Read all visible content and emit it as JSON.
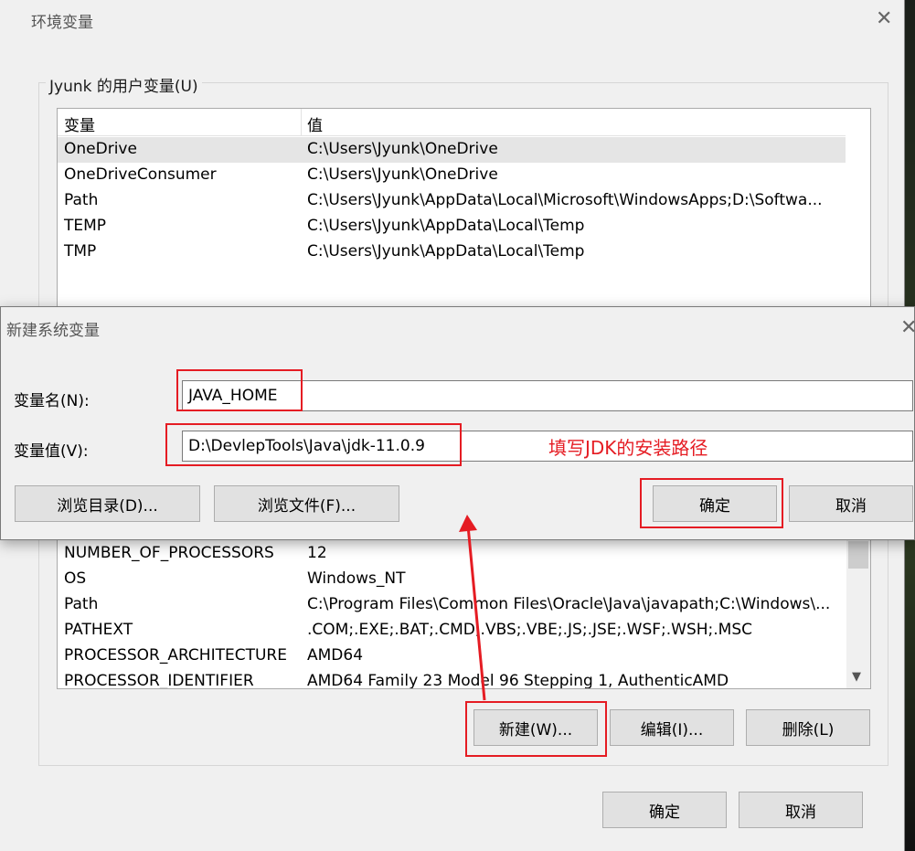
{
  "env_dialog": {
    "title": "环境变量",
    "user_group_label": "Jyunk 的用户变量(U)",
    "columns": [
      "变量",
      "值"
    ],
    "user_vars": [
      {
        "name": "OneDrive",
        "value": "C:\\Users\\Jyunk\\OneDrive"
      },
      {
        "name": "OneDriveConsumer",
        "value": "C:\\Users\\Jyunk\\OneDrive"
      },
      {
        "name": "Path",
        "value": "C:\\Users\\Jyunk\\AppData\\Local\\Microsoft\\WindowsApps;D:\\Softwa..."
      },
      {
        "name": "TEMP",
        "value": "C:\\Users\\Jyunk\\AppData\\Local\\Temp"
      },
      {
        "name": "TMP",
        "value": "C:\\Users\\Jyunk\\AppData\\Local\\Temp"
      }
    ],
    "system_vars": [
      {
        "name": "NUMBER_OF_PROCESSORS",
        "value": "12"
      },
      {
        "name": "OS",
        "value": "Windows_NT"
      },
      {
        "name": "Path",
        "value": "C:\\Program Files\\Common Files\\Oracle\\Java\\javapath;C:\\Windows\\..."
      },
      {
        "name": "PATHEXT",
        "value": ".COM;.EXE;.BAT;.CMD;.VBS;.VBE;.JS;.JSE;.WSF;.WSH;.MSC"
      },
      {
        "name": "PROCESSOR_ARCHITECTURE",
        "value": "AMD64"
      },
      {
        "name": "PROCESSOR_IDENTIFIER",
        "value": "AMD64 Family 23 Model 96 Stepping 1, AuthenticAMD"
      }
    ],
    "new_button": "新建(W)...",
    "edit_button": "编辑(I)...",
    "delete_button": "删除(L)",
    "ok_button": "确定",
    "cancel_button": "取消"
  },
  "new_dialog": {
    "title": "新建系统变量",
    "name_label": "变量名(N):",
    "name_value": "JAVA_HOME",
    "value_label": "变量值(V):",
    "value_value": "D:\\DevlepTools\\Java\\jdk-11.0.9",
    "browse_dir_button": "浏览目录(D)...",
    "browse_file_button": "浏览文件(F)...",
    "ok_button": "确定",
    "cancel_button": "取消"
  },
  "annotation": {
    "text": "填写JDK的安装路径",
    "color": "#e51c23"
  },
  "icons": {
    "close": "close-icon",
    "scroll_down": "chevron-down-icon"
  }
}
